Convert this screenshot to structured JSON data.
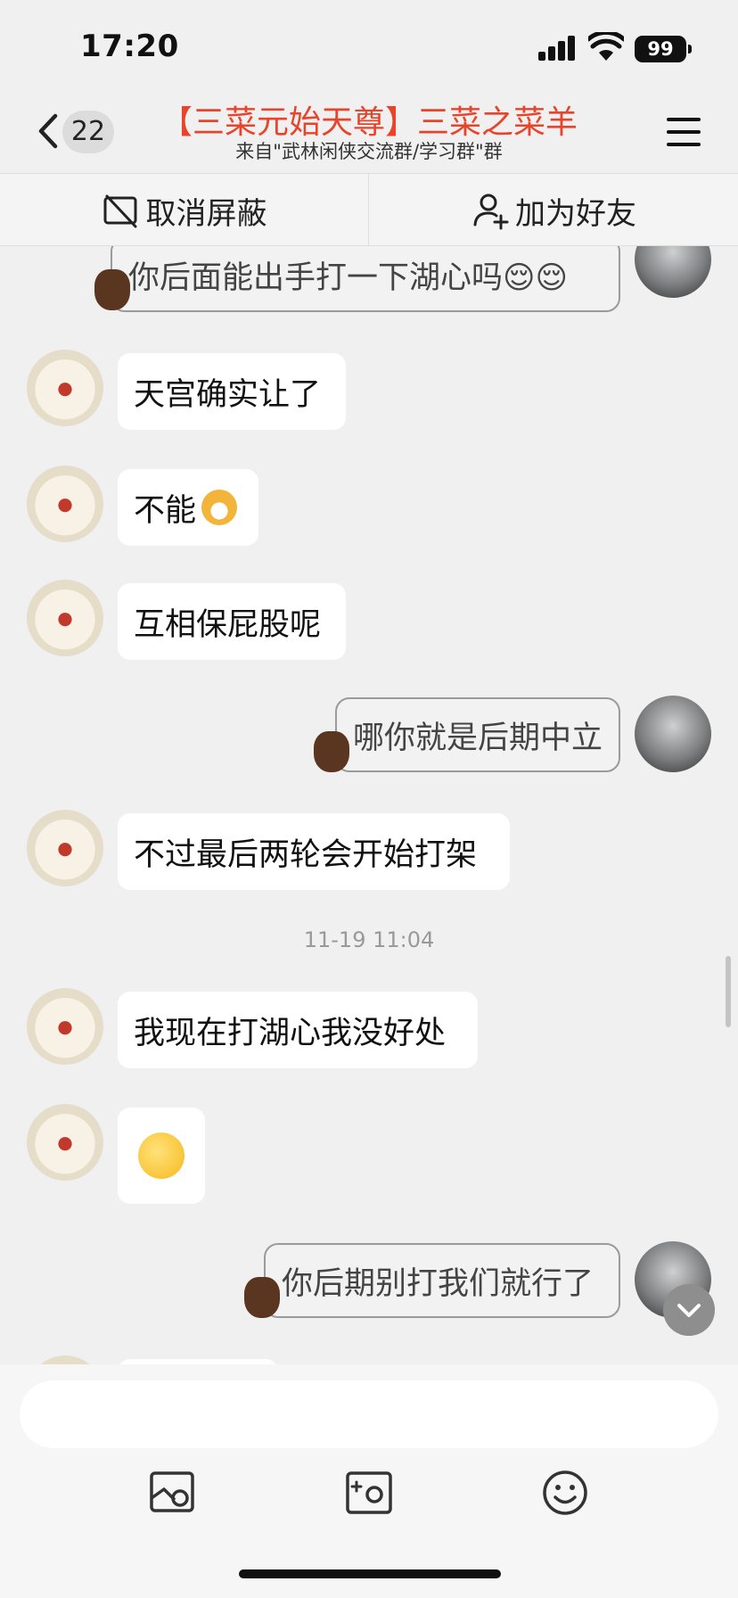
{
  "status_bar": {
    "time": "17:20",
    "battery": "99"
  },
  "header": {
    "unread_count": "22",
    "title": "【三菜元始天尊】三菜之菜羊",
    "subtitle": "来自\"武林闲侠交流群/学习群\"群"
  },
  "actions": {
    "unblock": "取消屏蔽",
    "add_friend": "加为好友"
  },
  "messages": [
    {
      "side": "right",
      "text": "你后面能出手打一下湖心吗😌😌"
    },
    {
      "side": "left",
      "text": "天宫确实让了"
    },
    {
      "side": "left",
      "text": "不能"
    },
    {
      "side": "left",
      "text": "互相保屁股呢"
    },
    {
      "side": "right",
      "text": "哪你就是后期中立"
    },
    {
      "side": "left",
      "text": "不过最后两轮会开始打架"
    },
    {
      "side": "left",
      "text": "我现在打湖心我没好处"
    },
    {
      "side": "left",
      "text": ""
    },
    {
      "side": "right",
      "text": "你后期别打我们就行了"
    }
  ],
  "timestamp": "11-19 11:04",
  "input": {
    "value": "",
    "placeholder": ""
  },
  "icons": {
    "back": "chevron-left-icon",
    "menu": "hamburger-menu-icon",
    "unblock": "block-slash-icon",
    "add_friend": "add-user-icon",
    "tools": [
      "image-icon",
      "camera-icon",
      "emoji-icon"
    ]
  },
  "colors": {
    "title": "#e8442b",
    "background": "#f0f0f0",
    "bubble": "#ffffff"
  }
}
